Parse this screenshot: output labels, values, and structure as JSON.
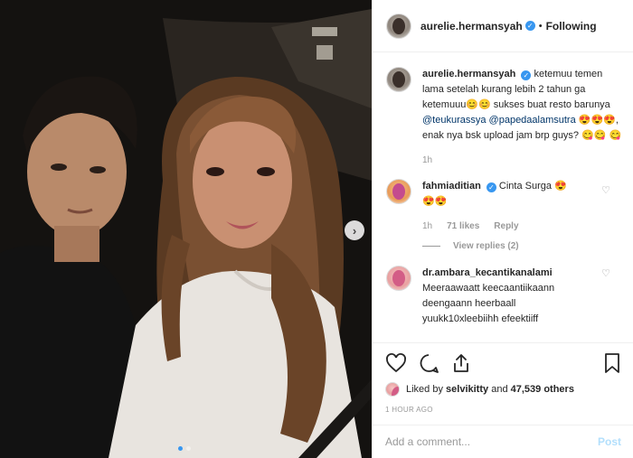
{
  "post": {
    "username": "aurelie.hermansyah",
    "separator": "•",
    "follow_status": "Following",
    "caption": {
      "username": "aurelie.hermansyah",
      "text_1": "ketemuu temen lama setelah kurang lebih 2 tahun ga ketemuuu",
      "emoji_1": "😊😊",
      "text_2": "sukses buat resto barunya",
      "mention_1": "@teukurassya",
      "mention_2": "@papedaalamsutra",
      "emoji_2": "😍😍😍",
      "text_3": ", enak nya bsk upload jam brp guys?",
      "emoji_3": "😋😋",
      "emoji_4": "😋",
      "time": "1h"
    },
    "comments": [
      {
        "username": "fahmiaditian",
        "text": "Cinta Surga",
        "emoji": "😍",
        "emoji_line2": "😍😍",
        "time": "1h",
        "likes": "71 likes",
        "reply": "Reply",
        "view_replies": "View replies (2)"
      },
      {
        "username": "dr.ambara_kecantikanalami",
        "text_1": "Meeraawaatt keecaantiikaann",
        "text_2": "deengaann heerbaall",
        "text_3": "yuukk10xleebiihh efeektiiff"
      }
    ],
    "likes": {
      "prefix": "Liked by",
      "user": "selvikitty",
      "connector": "and",
      "others": "47,539 others"
    },
    "timestamp": "1 HOUR AGO",
    "add_comment": {
      "placeholder": "Add a comment...",
      "post_label": "Post"
    },
    "carousel": {
      "next_glyph": "›",
      "total": 2,
      "active": 1
    }
  }
}
